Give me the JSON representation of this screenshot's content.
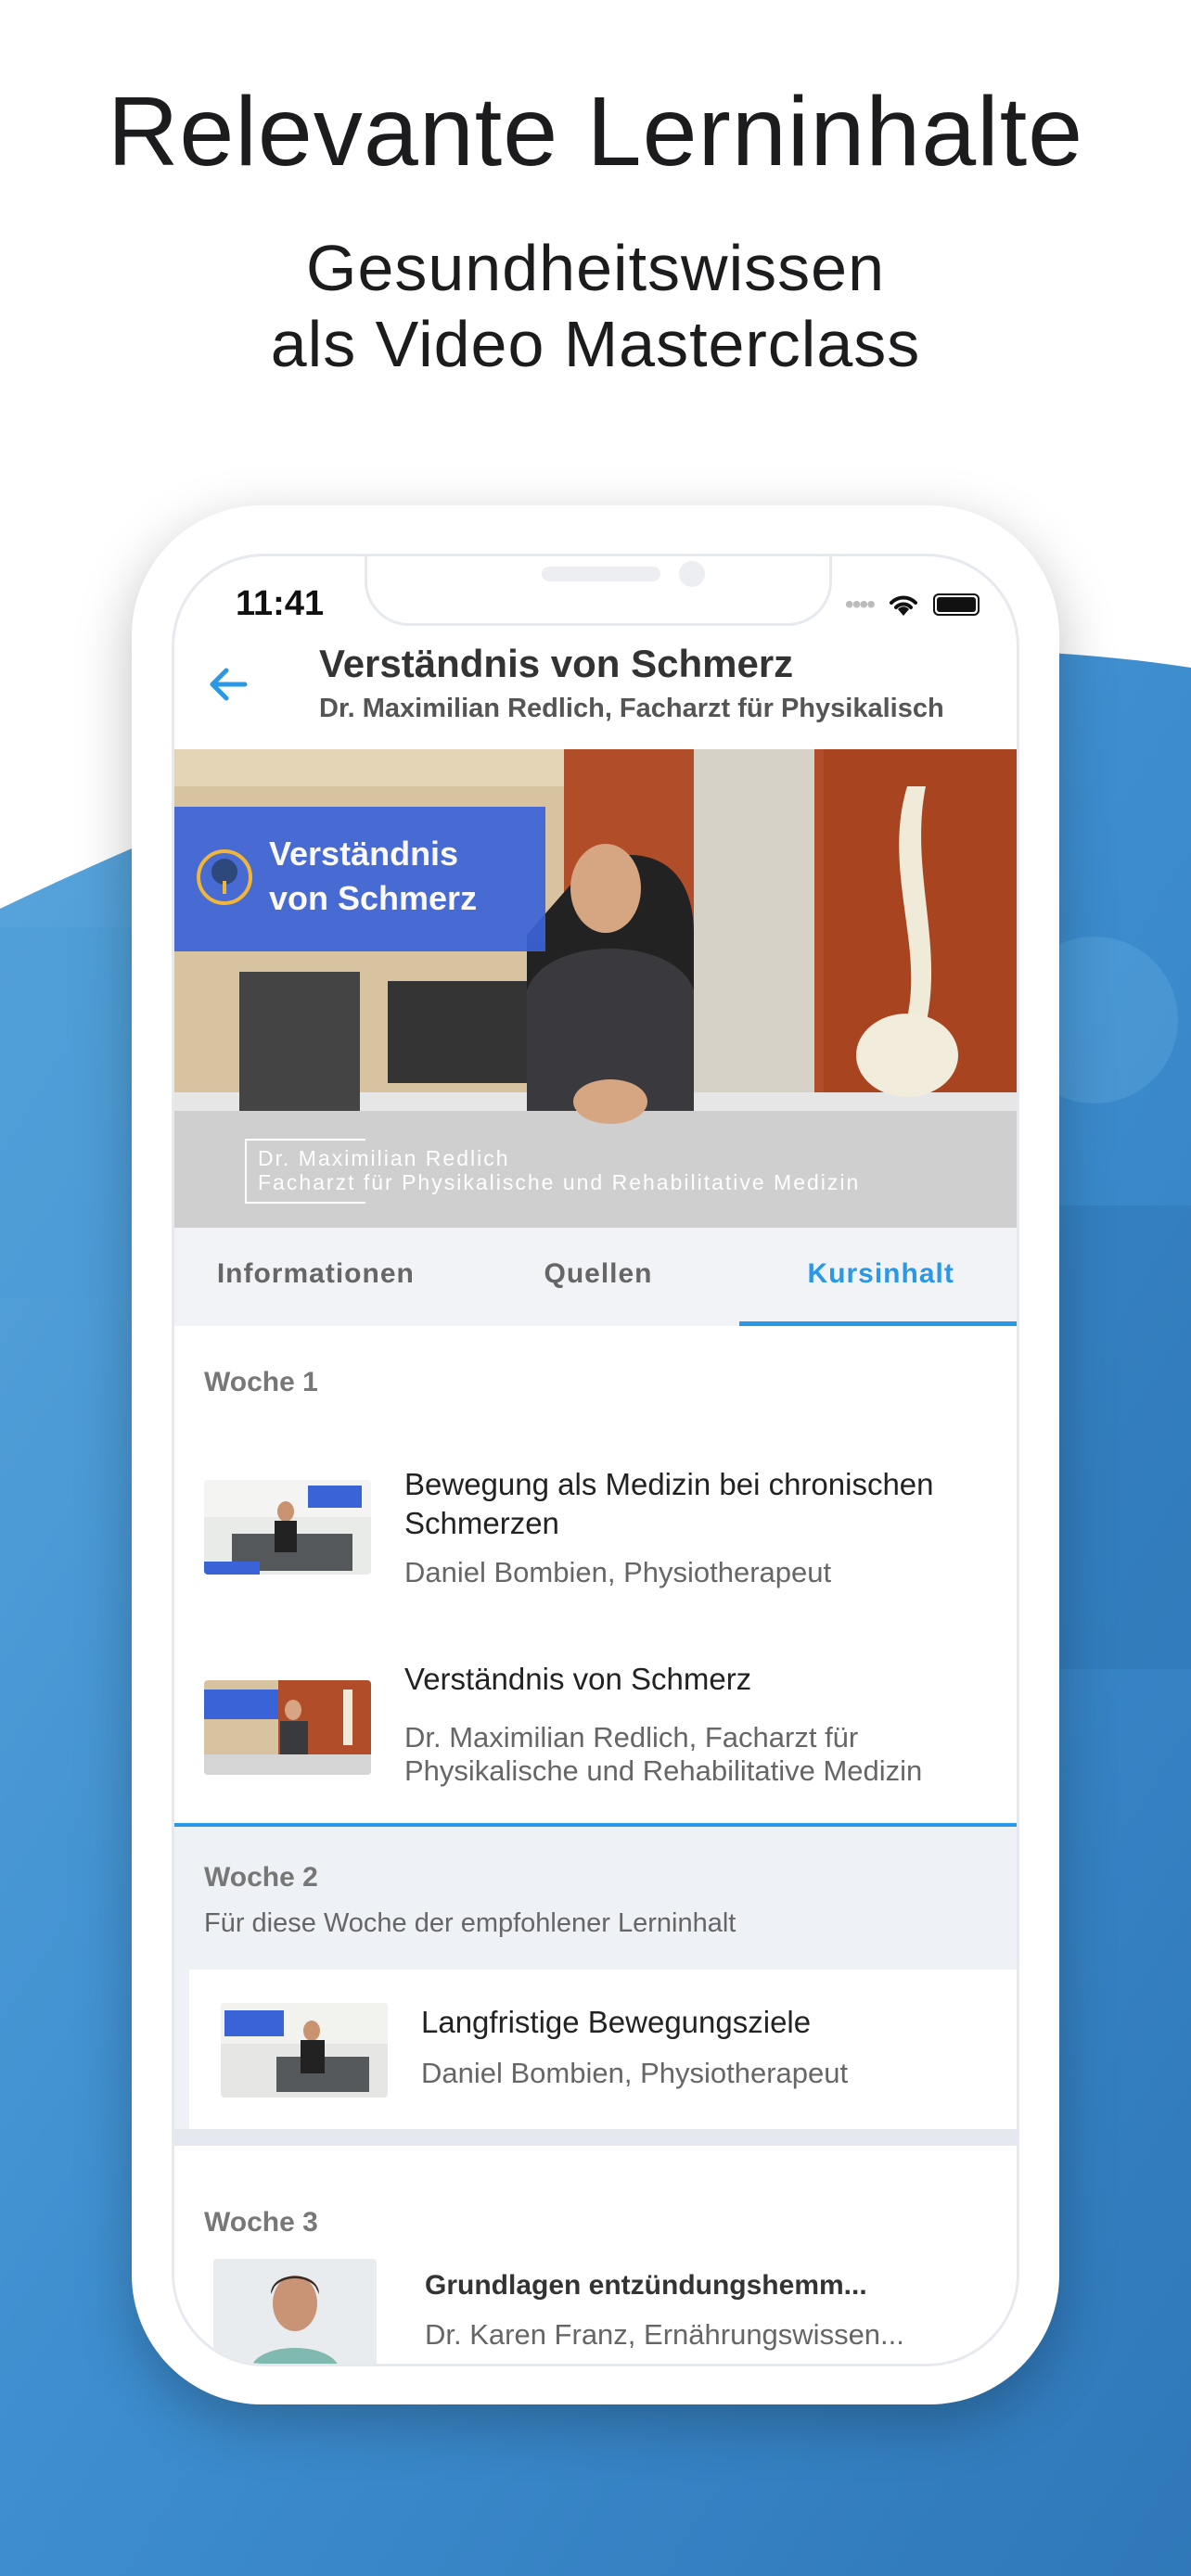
{
  "headline": "Relevante Lerninhalte",
  "subline_1": "Gesundheitswissen",
  "subline_2": "als Video Masterclass",
  "colors": {
    "accent": "#2b98e6",
    "bg_blue": "#3f8fd0"
  },
  "status_bar": {
    "time": "11:41"
  },
  "header": {
    "title": "Verständnis von Schmerz",
    "subtitle": "Dr. Maximilian Redlich, Facharzt für Physikalisch"
  },
  "video": {
    "overlay_title_1": "Verständnis",
    "overlay_title_2": "von Schmerz",
    "caption_1": "Dr. Maximilian Redlich",
    "caption_2": "Facharzt für Physikalische und Rehabilitative Medizin"
  },
  "tabs": [
    "Informationen",
    "Quellen",
    "Kursinhalt"
  ],
  "active_tab": "Kursinhalt",
  "weeks": [
    {
      "label": "Woche 1",
      "items": [
        {
          "title_1": "Bewegung als Medizin bei chronischen",
          "title_2": "Schmerzen",
          "author": "Daniel Bombien, Physiotherapeut"
        },
        {
          "title_1": "Verständnis von Schmerz",
          "author_1": "Dr. Maximilian Redlich, Facharzt für",
          "author_2": "Physikalische und Rehabilitative Medizin"
        }
      ]
    },
    {
      "label": "Woche 2",
      "note": "Für diese Woche der empfohlener Lerninhalt",
      "items": [
        {
          "title": "Langfristige Bewegungsziele",
          "author": "Daniel Bombien, Physiotherapeut"
        }
      ]
    },
    {
      "label": "Woche 3",
      "items": [
        {
          "title": "Grundlagen entzündungshemm...",
          "author": "Dr. Karen Franz, Ernährungswissen..."
        }
      ]
    }
  ]
}
